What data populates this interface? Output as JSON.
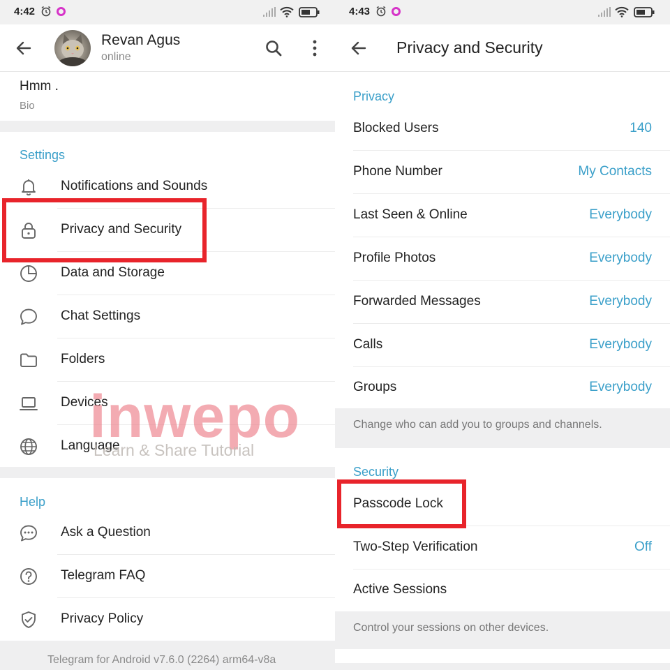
{
  "left": {
    "status": {
      "time": "4:42"
    },
    "header": {
      "name": "Revan Agus",
      "status": "online"
    },
    "bio": {
      "text": "Hmm .",
      "caption": "Bio"
    },
    "settings": {
      "title": "Settings",
      "items": [
        {
          "label": "Notifications and Sounds",
          "icon": "bell-icon"
        },
        {
          "label": "Privacy and Security",
          "icon": "lock-icon"
        },
        {
          "label": "Data and Storage",
          "icon": "pie-chart-icon"
        },
        {
          "label": "Chat Settings",
          "icon": "chat-bubble-icon"
        },
        {
          "label": "Folders",
          "icon": "folder-icon"
        },
        {
          "label": "Devices",
          "icon": "laptop-icon"
        },
        {
          "label": "Language",
          "icon": "globe-icon"
        }
      ]
    },
    "help": {
      "title": "Help",
      "items": [
        {
          "label": "Ask a Question",
          "icon": "chat-dots-icon"
        },
        {
          "label": "Telegram FAQ",
          "icon": "question-circle-icon"
        },
        {
          "label": "Privacy Policy",
          "icon": "shield-check-icon"
        }
      ]
    },
    "version": "Telegram for Android v7.6.0 (2264) arm64-v8a"
  },
  "right": {
    "status": {
      "time": "4:43"
    },
    "header": {
      "title": "Privacy and Security"
    },
    "privacy": {
      "title": "Privacy",
      "items": [
        {
          "label": "Blocked Users",
          "value": "140"
        },
        {
          "label": "Phone Number",
          "value": "My Contacts"
        },
        {
          "label": "Last Seen & Online",
          "value": "Everybody"
        },
        {
          "label": "Profile Photos",
          "value": "Everybody"
        },
        {
          "label": "Forwarded Messages",
          "value": "Everybody"
        },
        {
          "label": "Calls",
          "value": "Everybody"
        },
        {
          "label": "Groups",
          "value": "Everybody"
        }
      ],
      "info": "Change who can add you to groups and channels."
    },
    "security": {
      "title": "Security",
      "items": [
        {
          "label": "Passcode Lock",
          "value": ""
        },
        {
          "label": "Two-Step Verification",
          "value": "Off"
        },
        {
          "label": "Active Sessions",
          "value": ""
        }
      ],
      "info": "Control your sessions on other devices."
    }
  },
  "watermark": {
    "brand": "inwepo",
    "tagline": "Learn & Share Tutorial"
  },
  "colors": {
    "accent": "#3a9fc9",
    "highlight": "#e8242b",
    "notification": "#d633c8"
  }
}
